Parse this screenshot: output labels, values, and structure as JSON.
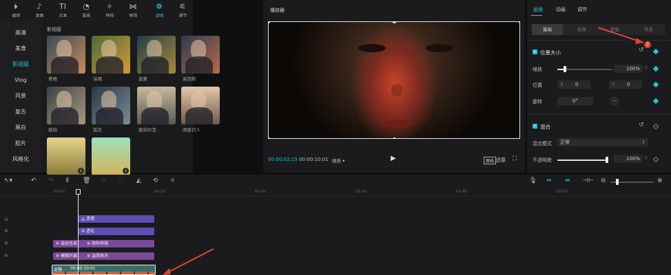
{
  "top_toolbar": [
    {
      "label": "媒体",
      "icon": "play-square-icon",
      "active": false
    },
    {
      "label": "音频",
      "icon": "music-note-icon",
      "active": false
    },
    {
      "label": "文本",
      "icon": "text-tool-icon",
      "active": false
    },
    {
      "label": "贴纸",
      "icon": "sticker-icon",
      "active": false
    },
    {
      "label": "特效",
      "icon": "sparkle-icon",
      "active": false
    },
    {
      "label": "转场",
      "icon": "transition-icon",
      "active": false
    },
    {
      "label": "滤镜",
      "icon": "filter-icon",
      "active": true
    },
    {
      "label": "调节",
      "icon": "adjust-sliders-icon",
      "active": false
    }
  ],
  "categories": [
    "高清",
    "美食",
    "影视级",
    "Vlog",
    "风景",
    "复古",
    "黑白",
    "胶片",
    "风格化"
  ],
  "active_category": "影视级",
  "section_title": "影视级",
  "filters": [
    {
      "label": "青橙",
      "style": "linear-gradient(135deg,#3a4a55,#c78b5c)"
    },
    {
      "label": "深褐",
      "style": "linear-gradient(135deg,#4d6a3a,#d29a3a)"
    },
    {
      "label": "蓝黄",
      "style": "linear-gradient(135deg,#1f3d47,#a88a3a)"
    },
    {
      "label": "高饱和",
      "style": "linear-gradient(135deg,#2c3a50,#b86a4a)"
    },
    {
      "label": "琥珀",
      "style": "linear-gradient(135deg,#3b4248,#a9997e)"
    },
    {
      "label": "蓝灰",
      "style": "linear-gradient(135deg,#2a3846,#7b8c95)"
    },
    {
      "label": "敦刻尔克",
      "style": "linear-gradient(180deg,#c7b89b,#5a5a55)"
    },
    {
      "label": "闻香识人",
      "style": "linear-gradient(180deg,#e3c7a8,#6f5a4c)"
    },
    {
      "label": "",
      "style": "linear-gradient(180deg,#e7d58a,#8a7a3a)"
    },
    {
      "label": "",
      "style": "linear-gradient(180deg,#9fe0c0,#d2b558)"
    }
  ],
  "player": {
    "title": "播放器",
    "current_time": "00:00:02:15",
    "total_time": "00:00:10:01",
    "ratio_label": "画质",
    "orig_badge": "原始",
    "restore_label": "还原"
  },
  "right_panel": {
    "tabs": [
      "画面",
      "动画",
      "调节"
    ],
    "active_tab": "画面",
    "sub_tabs": [
      "基础",
      "抠像",
      "蒙版",
      "背景"
    ],
    "active_sub": "基础",
    "pos_size_title": "位置大小",
    "badge_number": "2",
    "scale_label": "缩放",
    "scale_value": "100%",
    "scale_level": 0.14,
    "position_label": "位置",
    "x_label": "X",
    "x_value": "0",
    "y_label": "Y",
    "y_value": "0",
    "rotate_label": "旋转",
    "rotate_value": "0°",
    "blend_title": "混合",
    "blend_mode_label": "混合模式",
    "blend_mode_value": "正常",
    "opacity_label": "不透明度",
    "opacity_value": "100%",
    "opacity_level": 1.0
  },
  "timeline": {
    "ruler": [
      "00:00",
      "00:10",
      "00:20",
      "00:30",
      "00:40",
      "00:50"
    ],
    "clips": [
      {
        "label": "青橙",
        "kind": "blue"
      },
      {
        "label": "透化",
        "kind": "blue"
      },
      {
        "label": "波纹色差",
        "kind": "purple"
      },
      {
        "label": "颜料喷溅",
        "kind": "purple"
      },
      {
        "label": "模糊开幕",
        "kind": "purple"
      },
      {
        "label": "温柔晚冯",
        "kind": "purple"
      }
    ],
    "main_clip_label": "运镜",
    "main_clip_time": "00:00:10:01"
  }
}
